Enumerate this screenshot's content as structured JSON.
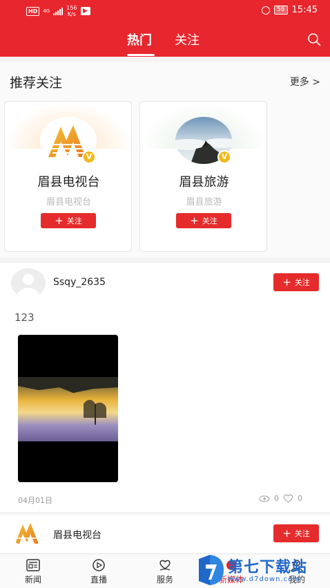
{
  "status_bar": {
    "hd": "HD",
    "network": "4G",
    "speed_value": "156",
    "speed_unit": "K/s",
    "battery": "56",
    "time": "15:45"
  },
  "header": {
    "tabs": [
      {
        "label": "热门",
        "active": true
      },
      {
        "label": "关注",
        "active": false
      }
    ],
    "search_icon": "search-icon"
  },
  "recommend": {
    "title": "推荐关注",
    "more": "更多 >",
    "cards": [
      {
        "name": "眉县电视台",
        "subtitle": "眉县电视台",
        "follow_label": "关注",
        "verified": "V"
      },
      {
        "name": "眉县旅游",
        "subtitle": "眉县旅游",
        "follow_label": "关注",
        "verified": "V"
      }
    ]
  },
  "posts": [
    {
      "user": "Ssqy_2635",
      "follow_label": "关注",
      "text": "123",
      "date": "04月01日",
      "views": "0",
      "likes": "0"
    },
    {
      "user": "眉县电视台",
      "follow_label": "关注"
    }
  ],
  "bottom_nav": [
    {
      "label": "新闻",
      "icon": "news-icon"
    },
    {
      "label": "直播",
      "icon": "live-icon"
    },
    {
      "label": "服务",
      "icon": "service-icon"
    },
    {
      "label": "新媒体",
      "icon": "media-icon",
      "active": true
    },
    {
      "label": "我的",
      "icon": "profile-icon"
    }
  ],
  "watermark": {
    "title": "第七下载站",
    "url": "www.d7down.com"
  },
  "colors": {
    "brand_red": "#e8262e",
    "verified_gold": "#f3b91a",
    "watermark_blue": "#1f67c8"
  }
}
